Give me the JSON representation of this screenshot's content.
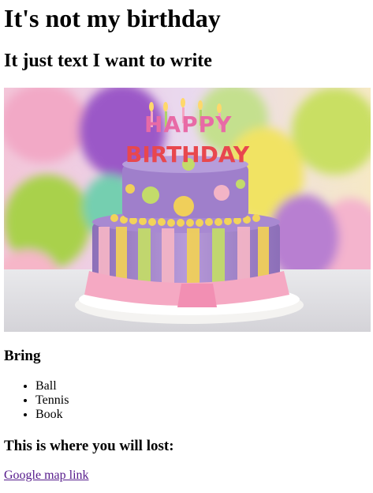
{
  "heading": "It's not my birthday",
  "subheading": "It just text I want to write",
  "image": {
    "alt": "birthday cake",
    "cake_text_top": "HAPPY",
    "cake_text_bottom": "BIRTHDAY"
  },
  "bring": {
    "heading": "Bring",
    "items": [
      "Ball",
      "Tennis",
      "Book"
    ]
  },
  "location": {
    "heading": "This is where you will lost:",
    "link_text": "Google map link"
  },
  "colors": {
    "link_visited": "#551a8b"
  }
}
